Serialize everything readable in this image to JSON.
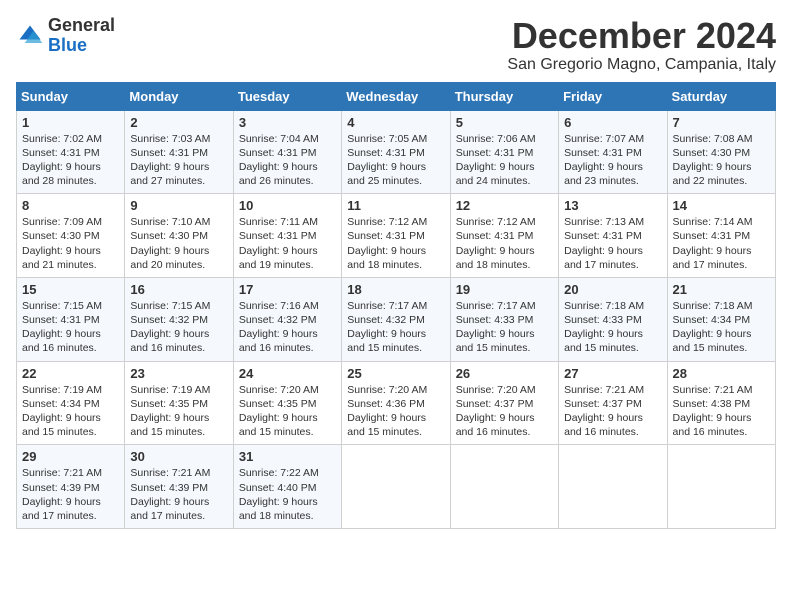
{
  "logo": {
    "general": "General",
    "blue": "Blue"
  },
  "title": "December 2024",
  "location": "San Gregorio Magno, Campania, Italy",
  "days_header": [
    "Sunday",
    "Monday",
    "Tuesday",
    "Wednesday",
    "Thursday",
    "Friday",
    "Saturday"
  ],
  "weeks": [
    [
      {
        "day": "1",
        "sunrise": "7:02 AM",
        "sunset": "4:31 PM",
        "daylight": "9 hours and 28 minutes."
      },
      {
        "day": "2",
        "sunrise": "7:03 AM",
        "sunset": "4:31 PM",
        "daylight": "9 hours and 27 minutes."
      },
      {
        "day": "3",
        "sunrise": "7:04 AM",
        "sunset": "4:31 PM",
        "daylight": "9 hours and 26 minutes."
      },
      {
        "day": "4",
        "sunrise": "7:05 AM",
        "sunset": "4:31 PM",
        "daylight": "9 hours and 25 minutes."
      },
      {
        "day": "5",
        "sunrise": "7:06 AM",
        "sunset": "4:31 PM",
        "daylight": "9 hours and 24 minutes."
      },
      {
        "day": "6",
        "sunrise": "7:07 AM",
        "sunset": "4:31 PM",
        "daylight": "9 hours and 23 minutes."
      },
      {
        "day": "7",
        "sunrise": "7:08 AM",
        "sunset": "4:30 PM",
        "daylight": "9 hours and 22 minutes."
      }
    ],
    [
      {
        "day": "8",
        "sunrise": "7:09 AM",
        "sunset": "4:30 PM",
        "daylight": "9 hours and 21 minutes."
      },
      {
        "day": "9",
        "sunrise": "7:10 AM",
        "sunset": "4:30 PM",
        "daylight": "9 hours and 20 minutes."
      },
      {
        "day": "10",
        "sunrise": "7:11 AM",
        "sunset": "4:31 PM",
        "daylight": "9 hours and 19 minutes."
      },
      {
        "day": "11",
        "sunrise": "7:12 AM",
        "sunset": "4:31 PM",
        "daylight": "9 hours and 18 minutes."
      },
      {
        "day": "12",
        "sunrise": "7:12 AM",
        "sunset": "4:31 PM",
        "daylight": "9 hours and 18 minutes."
      },
      {
        "day": "13",
        "sunrise": "7:13 AM",
        "sunset": "4:31 PM",
        "daylight": "9 hours and 17 minutes."
      },
      {
        "day": "14",
        "sunrise": "7:14 AM",
        "sunset": "4:31 PM",
        "daylight": "9 hours and 17 minutes."
      }
    ],
    [
      {
        "day": "15",
        "sunrise": "7:15 AM",
        "sunset": "4:31 PM",
        "daylight": "9 hours and 16 minutes."
      },
      {
        "day": "16",
        "sunrise": "7:15 AM",
        "sunset": "4:32 PM",
        "daylight": "9 hours and 16 minutes."
      },
      {
        "day": "17",
        "sunrise": "7:16 AM",
        "sunset": "4:32 PM",
        "daylight": "9 hours and 16 minutes."
      },
      {
        "day": "18",
        "sunrise": "7:17 AM",
        "sunset": "4:32 PM",
        "daylight": "9 hours and 15 minutes."
      },
      {
        "day": "19",
        "sunrise": "7:17 AM",
        "sunset": "4:33 PM",
        "daylight": "9 hours and 15 minutes."
      },
      {
        "day": "20",
        "sunrise": "7:18 AM",
        "sunset": "4:33 PM",
        "daylight": "9 hours and 15 minutes."
      },
      {
        "day": "21",
        "sunrise": "7:18 AM",
        "sunset": "4:34 PM",
        "daylight": "9 hours and 15 minutes."
      }
    ],
    [
      {
        "day": "22",
        "sunrise": "7:19 AM",
        "sunset": "4:34 PM",
        "daylight": "9 hours and 15 minutes."
      },
      {
        "day": "23",
        "sunrise": "7:19 AM",
        "sunset": "4:35 PM",
        "daylight": "9 hours and 15 minutes."
      },
      {
        "day": "24",
        "sunrise": "7:20 AM",
        "sunset": "4:35 PM",
        "daylight": "9 hours and 15 minutes."
      },
      {
        "day": "25",
        "sunrise": "7:20 AM",
        "sunset": "4:36 PM",
        "daylight": "9 hours and 15 minutes."
      },
      {
        "day": "26",
        "sunrise": "7:20 AM",
        "sunset": "4:37 PM",
        "daylight": "9 hours and 16 minutes."
      },
      {
        "day": "27",
        "sunrise": "7:21 AM",
        "sunset": "4:37 PM",
        "daylight": "9 hours and 16 minutes."
      },
      {
        "day": "28",
        "sunrise": "7:21 AM",
        "sunset": "4:38 PM",
        "daylight": "9 hours and 16 minutes."
      }
    ],
    [
      {
        "day": "29",
        "sunrise": "7:21 AM",
        "sunset": "4:39 PM",
        "daylight": "9 hours and 17 minutes."
      },
      {
        "day": "30",
        "sunrise": "7:21 AM",
        "sunset": "4:39 PM",
        "daylight": "9 hours and 17 minutes."
      },
      {
        "day": "31",
        "sunrise": "7:22 AM",
        "sunset": "4:40 PM",
        "daylight": "9 hours and 18 minutes."
      },
      null,
      null,
      null,
      null
    ]
  ],
  "labels": {
    "sunrise": "Sunrise:",
    "sunset": "Sunset:",
    "daylight": "Daylight:"
  }
}
